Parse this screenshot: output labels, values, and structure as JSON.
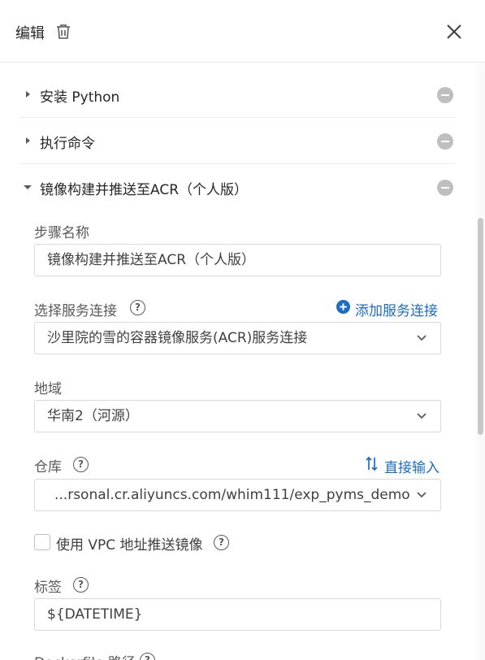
{
  "header": {
    "title": "编辑",
    "trash_icon": "trash-icon",
    "close_icon": "close-icon"
  },
  "steps": [
    {
      "label": "安装 Python",
      "expanded": false
    },
    {
      "label": "执行命令",
      "expanded": false
    },
    {
      "label": "镜像构建并推送至ACR（个人版）",
      "expanded": true
    }
  ],
  "form": {
    "step_name": {
      "label": "步骤名称",
      "value": "镜像构建并推送至ACR（个人版）"
    },
    "service_connection": {
      "label": "选择服务连接",
      "add_link": "添加服务连接",
      "value": "沙里院的雪的容器镜像服务(ACR)服务连接"
    },
    "region": {
      "label": "地域",
      "value": "华南2（河源）"
    },
    "repository": {
      "label": "仓库",
      "direct_input_link": "直接输入",
      "value": "...rsonal.cr.aliyuncs.com/whim111/exp_pyms_demo"
    },
    "vpc": {
      "label": "使用 VPC 地址推送镜像",
      "checked": false
    },
    "tag": {
      "label": "标签",
      "value": "${DATETIME}"
    },
    "dockerfile": {
      "label": "Dockerfile 路径"
    }
  },
  "colors": {
    "link": "#1b6ec2",
    "border": "#d9d9d9",
    "minus": "#bfbfbf"
  }
}
